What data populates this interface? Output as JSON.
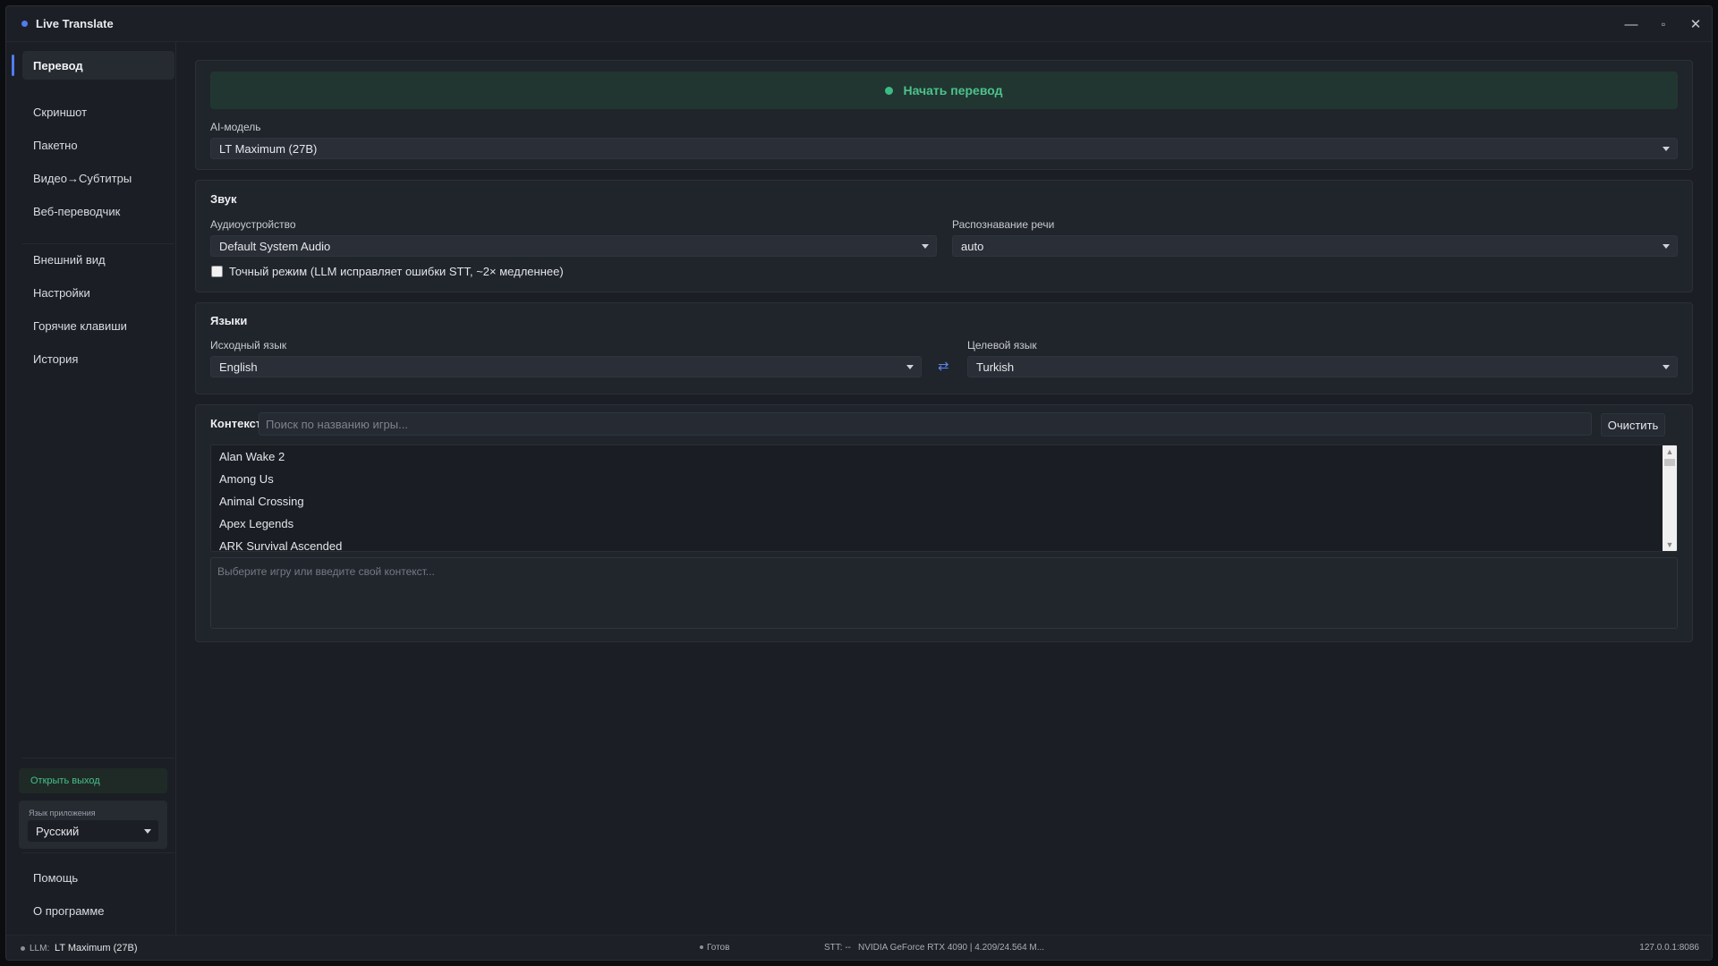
{
  "window": {
    "title": "Live Translate",
    "controls": [
      "—",
      "▫",
      "✕"
    ]
  },
  "sidebar": {
    "items": [
      {
        "label": "Перевод",
        "active": true
      },
      {
        "label": "Скриншот"
      },
      {
        "label": "Пакетно"
      },
      {
        "label": "Видео→Субтитры"
      },
      {
        "label": "Веб-переводчик"
      },
      {
        "label": "Внешний вид"
      },
      {
        "label": "Настройки"
      },
      {
        "label": "Горячие клавиши"
      },
      {
        "label": "История"
      }
    ],
    "open_output": "Открыть выход",
    "app_language_label": "Язык приложения",
    "app_language_value": "Русский",
    "help": "Помощь",
    "about": "О программе"
  },
  "main": {
    "start_button": "Начать перевод",
    "ai_model_label": "AI-модель",
    "ai_model_value": "LT Maximum (27B)",
    "sound": {
      "title": "Звук",
      "device_label": "Аудиоустройство",
      "device_value": "Default System Audio",
      "stt_label": "Распознавание речи",
      "stt_value": "auto",
      "precise_mode_label": "Точный режим (LLM исправляет ошибки STT, ~2× медленнее)",
      "precise_mode_checked": false
    },
    "languages": {
      "title": "Языки",
      "source_label": "Исходный язык",
      "source_value": "English",
      "target_label": "Целевой язык",
      "target_value": "Turkish",
      "swap_icon": "⇄"
    },
    "context": {
      "title": "Контекст",
      "search_placeholder": "Поиск по названию игры...",
      "clear_button": "Очистить",
      "games": [
        "Alan Wake 2",
        "Among Us",
        "Animal Crossing",
        "Apex Legends",
        "ARK Survival Ascended"
      ],
      "text_placeholder": "Выберите игру или введите свой контекст..."
    }
  },
  "status": {
    "llm_prefix": "LLM:",
    "llm_value": "LT Maximum (27B)",
    "state": "Готов",
    "stt": "STT: --",
    "gpu": "NVIDIA GeForce RTX 4090 | 4.209/24.564 M...",
    "address": "127.0.0.1:8086"
  }
}
